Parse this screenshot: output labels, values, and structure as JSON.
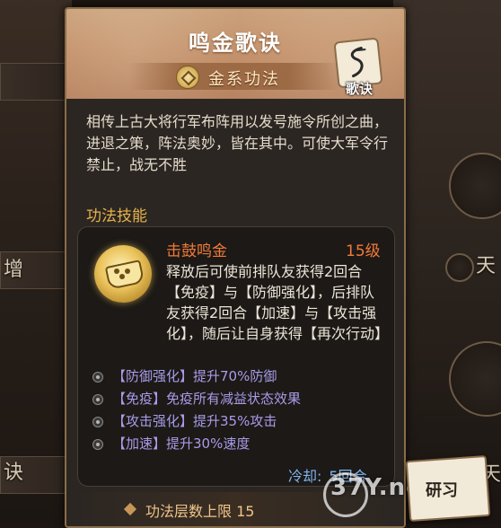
{
  "background": {
    "left_chips": [
      "增",
      "诀"
    ],
    "right_chip": "天",
    "right_bottom_chip": "周天"
  },
  "panel": {
    "title": "鸣金歌诀",
    "subtitle": "金系功法",
    "badge_label": "歌诀",
    "description": "相传上古大将行军布阵用以发号施令所创之曲，进退之策，阵法奥妙，皆在其中。可使大军令行禁止，战无不胜",
    "section_title": "功法技能",
    "skill": {
      "name": "击鼓鸣金",
      "level": "15级",
      "description": "释放后可使前排队友获得2回合【免疫】与【防御强化】，后排队友获得2回合【加速】与【攻击强化】，随后让自身获得【再次行动】",
      "effects": [
        "【防御强化】提升70%防御",
        "【免疫】免疫所有减益状态效果",
        "【攻击强化】提升35%攻击",
        "【加速】提升30%速度"
      ],
      "cooldown_label": "冷却:",
      "cooldown_value": "5回合"
    },
    "footer": "功法层数上限 15"
  },
  "research_button": "研习",
  "watermark": "37Y.net",
  "colors": {
    "header": "#c3916a",
    "skill_name": "#f07a3a",
    "effects": "#a99be8",
    "cooldown": "#7fb4f0",
    "section_title": "#e7b24c"
  }
}
